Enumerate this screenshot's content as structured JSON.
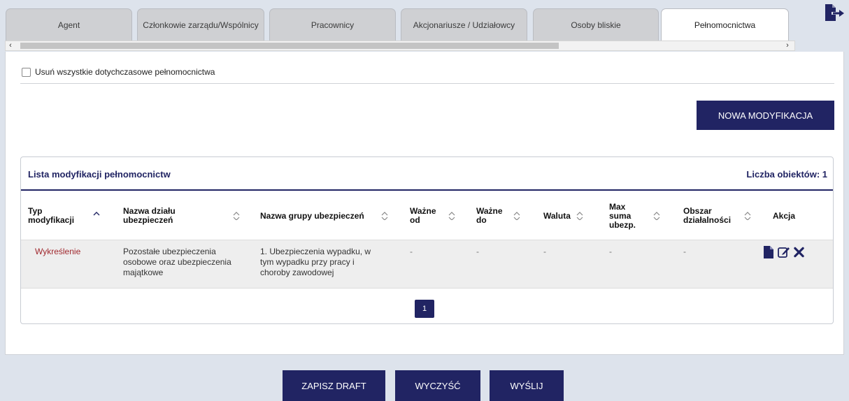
{
  "tabs": [
    {
      "label": "Agent",
      "active": false
    },
    {
      "label": "Członkowie zarządu/Wspólnicy",
      "active": false
    },
    {
      "label": "Pracownicy",
      "active": false
    },
    {
      "label": "Akcjonariusze / Udziałowcy",
      "active": false
    },
    {
      "label": "Osoby bliskie",
      "active": false
    },
    {
      "label": "Pełnomocnictwa",
      "active": true
    }
  ],
  "scrollbar": {
    "left_arrow": "‹",
    "right_arrow": "›"
  },
  "icons": {
    "logout": "logout-icon",
    "file": "file-icon",
    "edit": "edit-icon",
    "delete": "close-icon"
  },
  "colors": {
    "primary": "#212463",
    "accent_red": "#a0282e",
    "background": "#dde3ec"
  },
  "checkbox": {
    "label": "Usuń wszystkie dotychczasowe pełnomocnictwa",
    "checked": false
  },
  "new_button": "NOWA MODYFIKACJA",
  "list": {
    "title": "Lista modyfikacji pełnomocnictw",
    "count_label": "Liczba obiektów: 1",
    "columns": [
      "Typ modyfikacji",
      "Nazwa działu ubezpieczeń",
      "Nazwa grupy ubezpieczeń",
      "Ważne od",
      "Ważne do",
      "Waluta",
      "Max suma ubezp.",
      "Obszar działalności",
      "Akcja"
    ],
    "rows": [
      {
        "typ": "Wykreślenie",
        "dzial": "Pozostałe ubezpieczenia osobowe oraz ubezpieczenia majątkowe",
        "grupa": "1. Ubezpieczenia wypadku, w tym wypadku przy pracy i choroby zawodowej",
        "od": "-",
        "do": "-",
        "waluta": "-",
        "suma": "-",
        "obszar": "-"
      }
    ],
    "page": "1"
  },
  "footer": {
    "draft": "ZAPISZ DRAFT",
    "clear": "WYCZYŚĆ",
    "send": "WYŚLIJ"
  }
}
